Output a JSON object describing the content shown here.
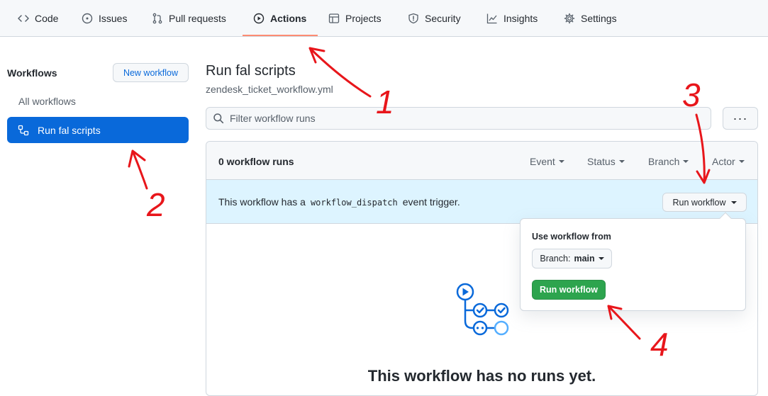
{
  "nav": {
    "tabs": [
      {
        "label": "Code",
        "icon": "code-icon"
      },
      {
        "label": "Issues",
        "icon": "issue-opened-icon"
      },
      {
        "label": "Pull requests",
        "icon": "git-pull-request-icon"
      },
      {
        "label": "Actions",
        "icon": "play-icon",
        "active": true
      },
      {
        "label": "Projects",
        "icon": "table-icon"
      },
      {
        "label": "Security",
        "icon": "shield-icon"
      },
      {
        "label": "Insights",
        "icon": "graph-icon"
      },
      {
        "label": "Settings",
        "icon": "gear-icon"
      }
    ]
  },
  "sidebar": {
    "title": "Workflows",
    "new_workflow": "New workflow",
    "items": [
      {
        "label": "All workflows"
      },
      {
        "label": "Run fal scripts",
        "selected": true,
        "icon": "workflow-icon"
      }
    ]
  },
  "main": {
    "title": "Run fal scripts",
    "subtitle": "zendesk_ticket_workflow.yml",
    "filter_placeholder": "Filter workflow runs",
    "more_label": "···",
    "runs_count": "0 workflow runs",
    "filters": [
      "Event",
      "Status",
      "Branch",
      "Actor"
    ],
    "banner": {
      "prefix": "This workflow has a",
      "code": "workflow_dispatch",
      "suffix": "event trigger."
    },
    "run_workflow_button": "Run workflow",
    "empty_title": "This workflow has no runs yet."
  },
  "popover": {
    "label": "Use workflow from",
    "branch_prefix": "Branch:",
    "branch_value": "main",
    "run_button": "Run workflow"
  },
  "annotations": {
    "color": "#e8161b",
    "labels": [
      "1",
      "2",
      "3",
      "4"
    ]
  },
  "colors": {
    "accent_blue": "#0969da",
    "nav_underline": "#fd8c73",
    "banner_bg": "#ddf4ff",
    "green_button": "#2da44e",
    "workflow_graphic": "#0969da"
  }
}
